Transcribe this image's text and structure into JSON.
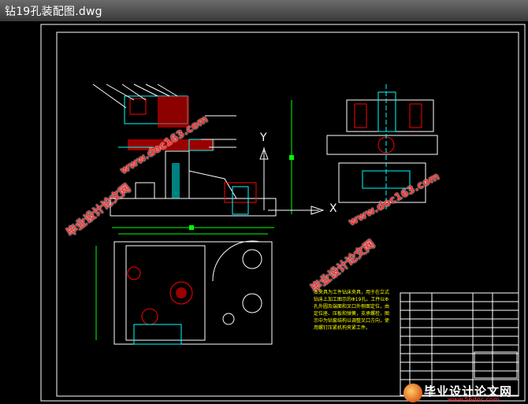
{
  "window": {
    "title": "钻19孔装配图.dwg"
  },
  "drawing": {
    "axis_y_label": "Y",
    "axis_x_label": "X",
    "notes_text": "本夹具为工件钻床夹具，用于在立式钻床上加工图示的Φ19孔。工件以Φ孔外圆及端面和叉口外侧面定位，由定位座、压板和弹簧，支承螺栓，图示中为钻套结构以调整叉口方向，使用螺钉压紧机构夹紧工件。"
  },
  "watermarks": {
    "site_main": "毕业设计论文网",
    "site_url": "www.doc163.com",
    "site_url_2": "WWW.56doc.com"
  },
  "logo": {
    "main": "毕业设计论文网",
    "url": "www.56doc.com"
  },
  "colors": {
    "background": "#000000",
    "frame": "#ffffff",
    "part_red": "#ff0000",
    "part_cyan": "#00ffff",
    "dim_green": "#00ff00",
    "note_yellow": "#ffff00",
    "watermark_red": "#e33333"
  }
}
